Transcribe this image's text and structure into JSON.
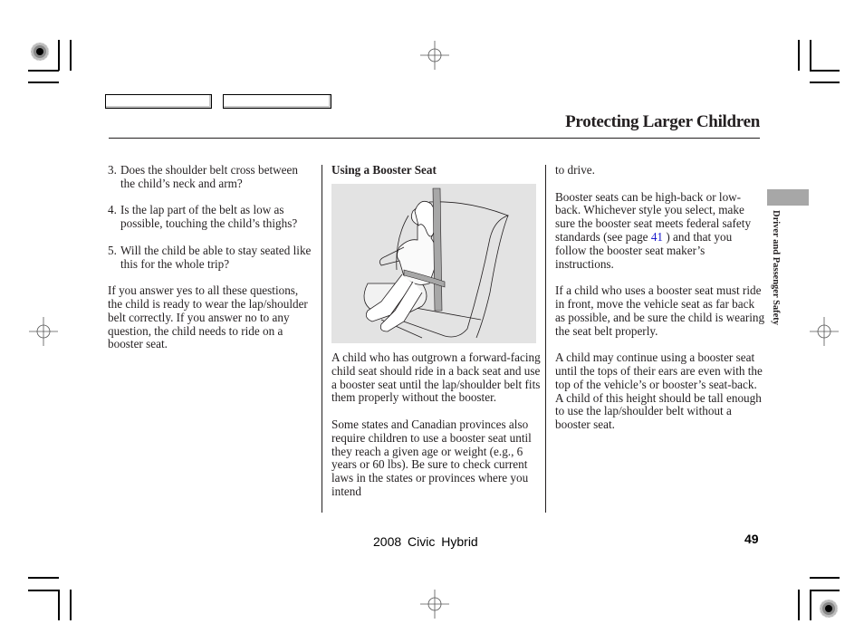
{
  "nav": {
    "buttons": [
      {
        "label": ""
      },
      {
        "label": ""
      }
    ]
  },
  "header": {
    "title": "Protecting Larger Children"
  },
  "column1": {
    "list": [
      {
        "num": "3.",
        "text": "Does the shoulder belt cross between the child’s neck and arm?"
      },
      {
        "num": "4.",
        "text": "Is the lap part of the belt as low as possible, touching the child’s thighs?"
      },
      {
        "num": "5.",
        "text": "Will the child be able to stay seated like this for the whole trip?"
      }
    ],
    "paragraph": "If you answer yes to all these questions, the child is ready to wear the lap/shoulder belt correctly. If you answer no to any question, the child needs to ride on a booster seat."
  },
  "column2": {
    "heading": "Using a Booster Seat",
    "illustration": "child-in-booster-seat",
    "paragraphs": [
      "A child who has outgrown a forward-facing child seat should ride in a back seat and use a booster seat until the lap/shoulder belt fits them properly without the booster.",
      "Some states and Canadian provinces also require children to use a booster seat until they reach a given age or weight (e.g., 6 years or 60 lbs). Be sure to check current laws in the states or provinces where you intend"
    ]
  },
  "column3": {
    "continuation": "to drive.",
    "p1_before": "Booster seats can be high-back or low-back. Whichever style you select, make sure the booster seat meets federal safety standards (see page",
    "p1_link": "41",
    "p1_after": ") and that you follow the booster seat maker’s instructions.",
    "p2": "If a child who uses a booster seat must ride in front, move the vehicle seat as far back as possible, and be sure the child is wearing the seat belt properly.",
    "p3": "A child may continue using a booster seat until the tops of their ears are even with the top of the vehicle’s or booster’s seat-back. A child of this height should be tall enough to use the lap/shoulder belt without a booster seat."
  },
  "side": {
    "section_label": "Driver and Passenger Safety",
    "tab_color": "#a7a7a7"
  },
  "footer": {
    "model": "2008  Civic  Hybrid",
    "page_number": "49"
  },
  "colors": {
    "link": "#1a1acc",
    "illustration_bg": "#e3e3e3"
  }
}
